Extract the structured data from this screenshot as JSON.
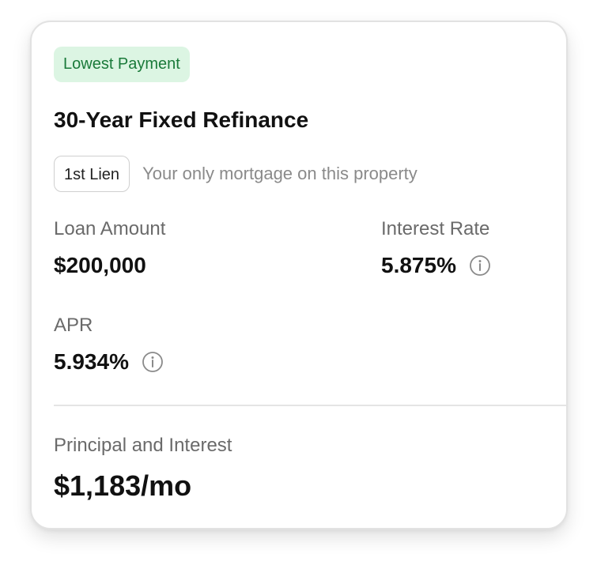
{
  "badge": {
    "label": "Lowest Payment"
  },
  "product": {
    "title": "30-Year Fixed Refinance",
    "lien_tag": "1st Lien",
    "lien_description": "Your only mortgage on this property"
  },
  "details": {
    "loan_amount_label": "Loan Amount",
    "loan_amount_value": "$200,000",
    "interest_rate_label": "Interest Rate",
    "interest_rate_value": "5.875%",
    "apr_label": "APR",
    "apr_value": "5.934%"
  },
  "payment": {
    "label": "Principal and Interest",
    "value": "$1,183/mo"
  },
  "icons": {
    "interest_rate_info": "info-icon",
    "apr_info": "info-icon"
  },
  "colors": {
    "badge_bg": "#dcf5e3",
    "badge_text": "#1a7a3a"
  }
}
